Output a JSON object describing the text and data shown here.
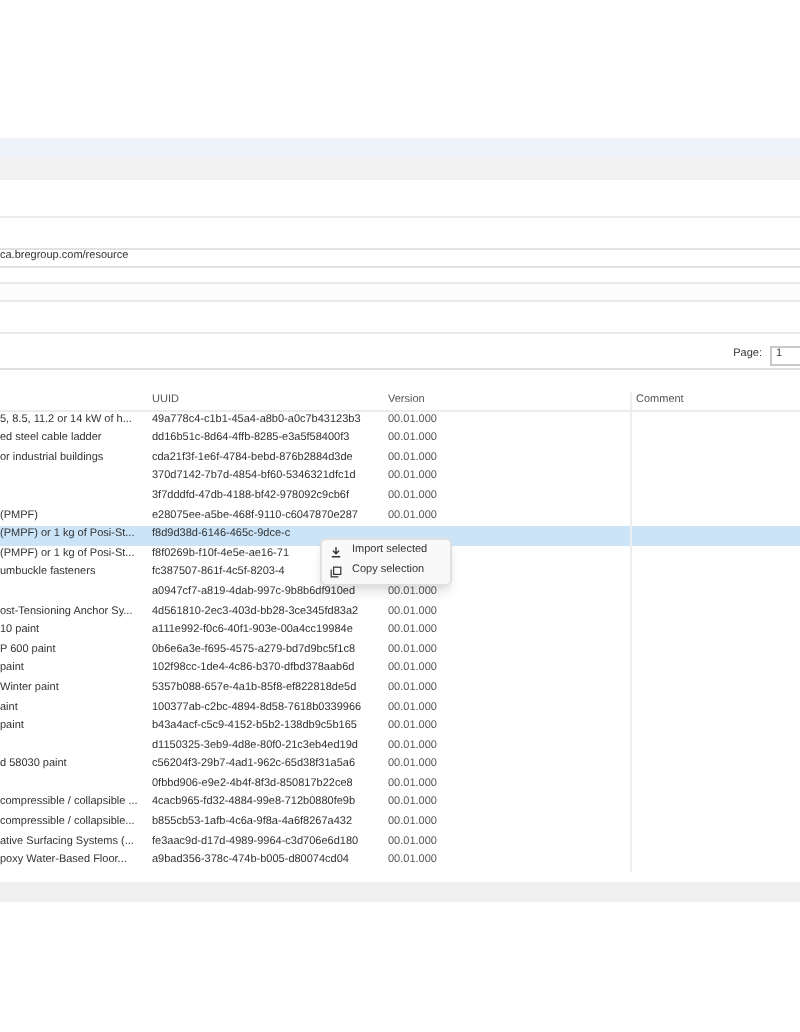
{
  "url_field": {
    "value": "ca.bregroup.com/resource"
  },
  "pager": {
    "label": "Page:",
    "value": "1"
  },
  "table": {
    "columns": [
      "UUID",
      "Version",
      "Comment"
    ],
    "rows": [
      {
        "name": "5, 8.5, 11.2 or 14 kW of h...",
        "uuid": "49a778c4-c1b1-45a4-a8b0-a0c7b43123b3",
        "version": "00.01.000",
        "selected": false
      },
      {
        "name": "ed steel cable ladder",
        "uuid": "dd16b51c-8d64-4ffb-8285-e3a5f58400f3",
        "version": "00.01.000",
        "selected": false
      },
      {
        "name": "or industrial buildings",
        "uuid": "cda21f3f-1e6f-4784-bebd-876b2884d3de",
        "version": "00.01.000",
        "selected": false
      },
      {
        "uuid": "370d7142-7b7d-4854-bf60-5346321dfc1d",
        "version": "00.01.000",
        "selected": false
      },
      {
        "uuid": "3f7dddfd-47db-4188-bf42-978092c9cb6f",
        "version": "00.01.000",
        "selected": false
      },
      {
        "name": "(PMPF)",
        "uuid": "e28075ee-a5be-468f-9110-c6047870e287",
        "version": "00.01.000",
        "selected": false
      },
      {
        "name": "(PMPF) or 1 kg of Posi-St...",
        "uuid": "f8d9d38d-6146-465c-9dce-c",
        "selected": true
      },
      {
        "name": "(PMPF) or 1 kg of Posi-St...",
        "uuid": "f8f0269b-f10f-4e5e-ae16-71",
        "selected": false
      },
      {
        "name": "umbuckle fasteners",
        "uuid": "fc387507-861f-4c5f-8203-4",
        "selected": false
      },
      {
        "uuid": "a0947cf7-a819-4dab-997c-9b8b6df910ed",
        "version": "00.01.000",
        "selected": false
      },
      {
        "name": "ost-Tensioning Anchor Sy...",
        "uuid": "4d561810-2ec3-403d-bb28-3ce345fd83a2",
        "version": "00.01.000",
        "selected": false
      },
      {
        "name": "10 paint",
        "uuid": "a111e992-f0c6-40f1-903e-00a4cc19984e",
        "version": "00.01.000",
        "selected": false
      },
      {
        "name": "P 600 paint",
        "uuid": "0b6e6a3e-f695-4575-a279-bd7d9bc5f1c8",
        "version": "00.01.000",
        "selected": false
      },
      {
        "name": "paint",
        "uuid": "102f98cc-1de4-4c86-b370-dfbd378aab6d",
        "version": "00.01.000",
        "selected": false
      },
      {
        "name": "Winter paint",
        "uuid": "5357b088-657e-4a1b-85f8-ef822818de5d",
        "version": "00.01.000",
        "selected": false
      },
      {
        "name": "aint",
        "uuid": "100377ab-c2bc-4894-8d58-7618b0339966",
        "version": "00.01.000",
        "selected": false
      },
      {
        "name": "paint",
        "uuid": "b43a4acf-c5c9-4152-b5b2-138db9c5b165",
        "version": "00.01.000",
        "selected": false
      },
      {
        "uuid": "d1150325-3eb9-4d8e-80f0-21c3eb4ed19d",
        "version": "00.01.000",
        "selected": false
      },
      {
        "name": "d 58030 paint",
        "uuid": "c56204f3-29b7-4ad1-962c-65d38f31a5a6",
        "version": "00.01.000",
        "selected": false
      },
      {
        "uuid": "0fbbd906-e9e2-4b4f-8f3d-850817b22ce8",
        "version": "00.01.000",
        "selected": false
      },
      {
        "name": "compressible / collapsible ...",
        "uuid": "4cacb965-fd32-4884-99e8-712b0880fe9b",
        "version": "00.01.000",
        "selected": false
      },
      {
        "name": "compressible / collapsible...",
        "uuid": "b855cb53-1afb-4c6a-9f8a-4a6f8267a432",
        "version": "00.01.000",
        "selected": false
      },
      {
        "name": "ative Surfacing Systems (...",
        "uuid": "fe3aac9d-d17d-4989-9964-c3d706e6d180",
        "version": "00.01.000",
        "selected": false
      },
      {
        "name": "poxy Water-Based Floor...",
        "uuid": "a9bad356-378c-474b-b005-d80074cd04",
        "version": "00.01.000",
        "selected": false
      }
    ]
  },
  "context_menu": {
    "items": [
      {
        "label": "Import selected",
        "kind": "import"
      },
      {
        "label": "Copy selection",
        "kind": "copy"
      }
    ]
  }
}
